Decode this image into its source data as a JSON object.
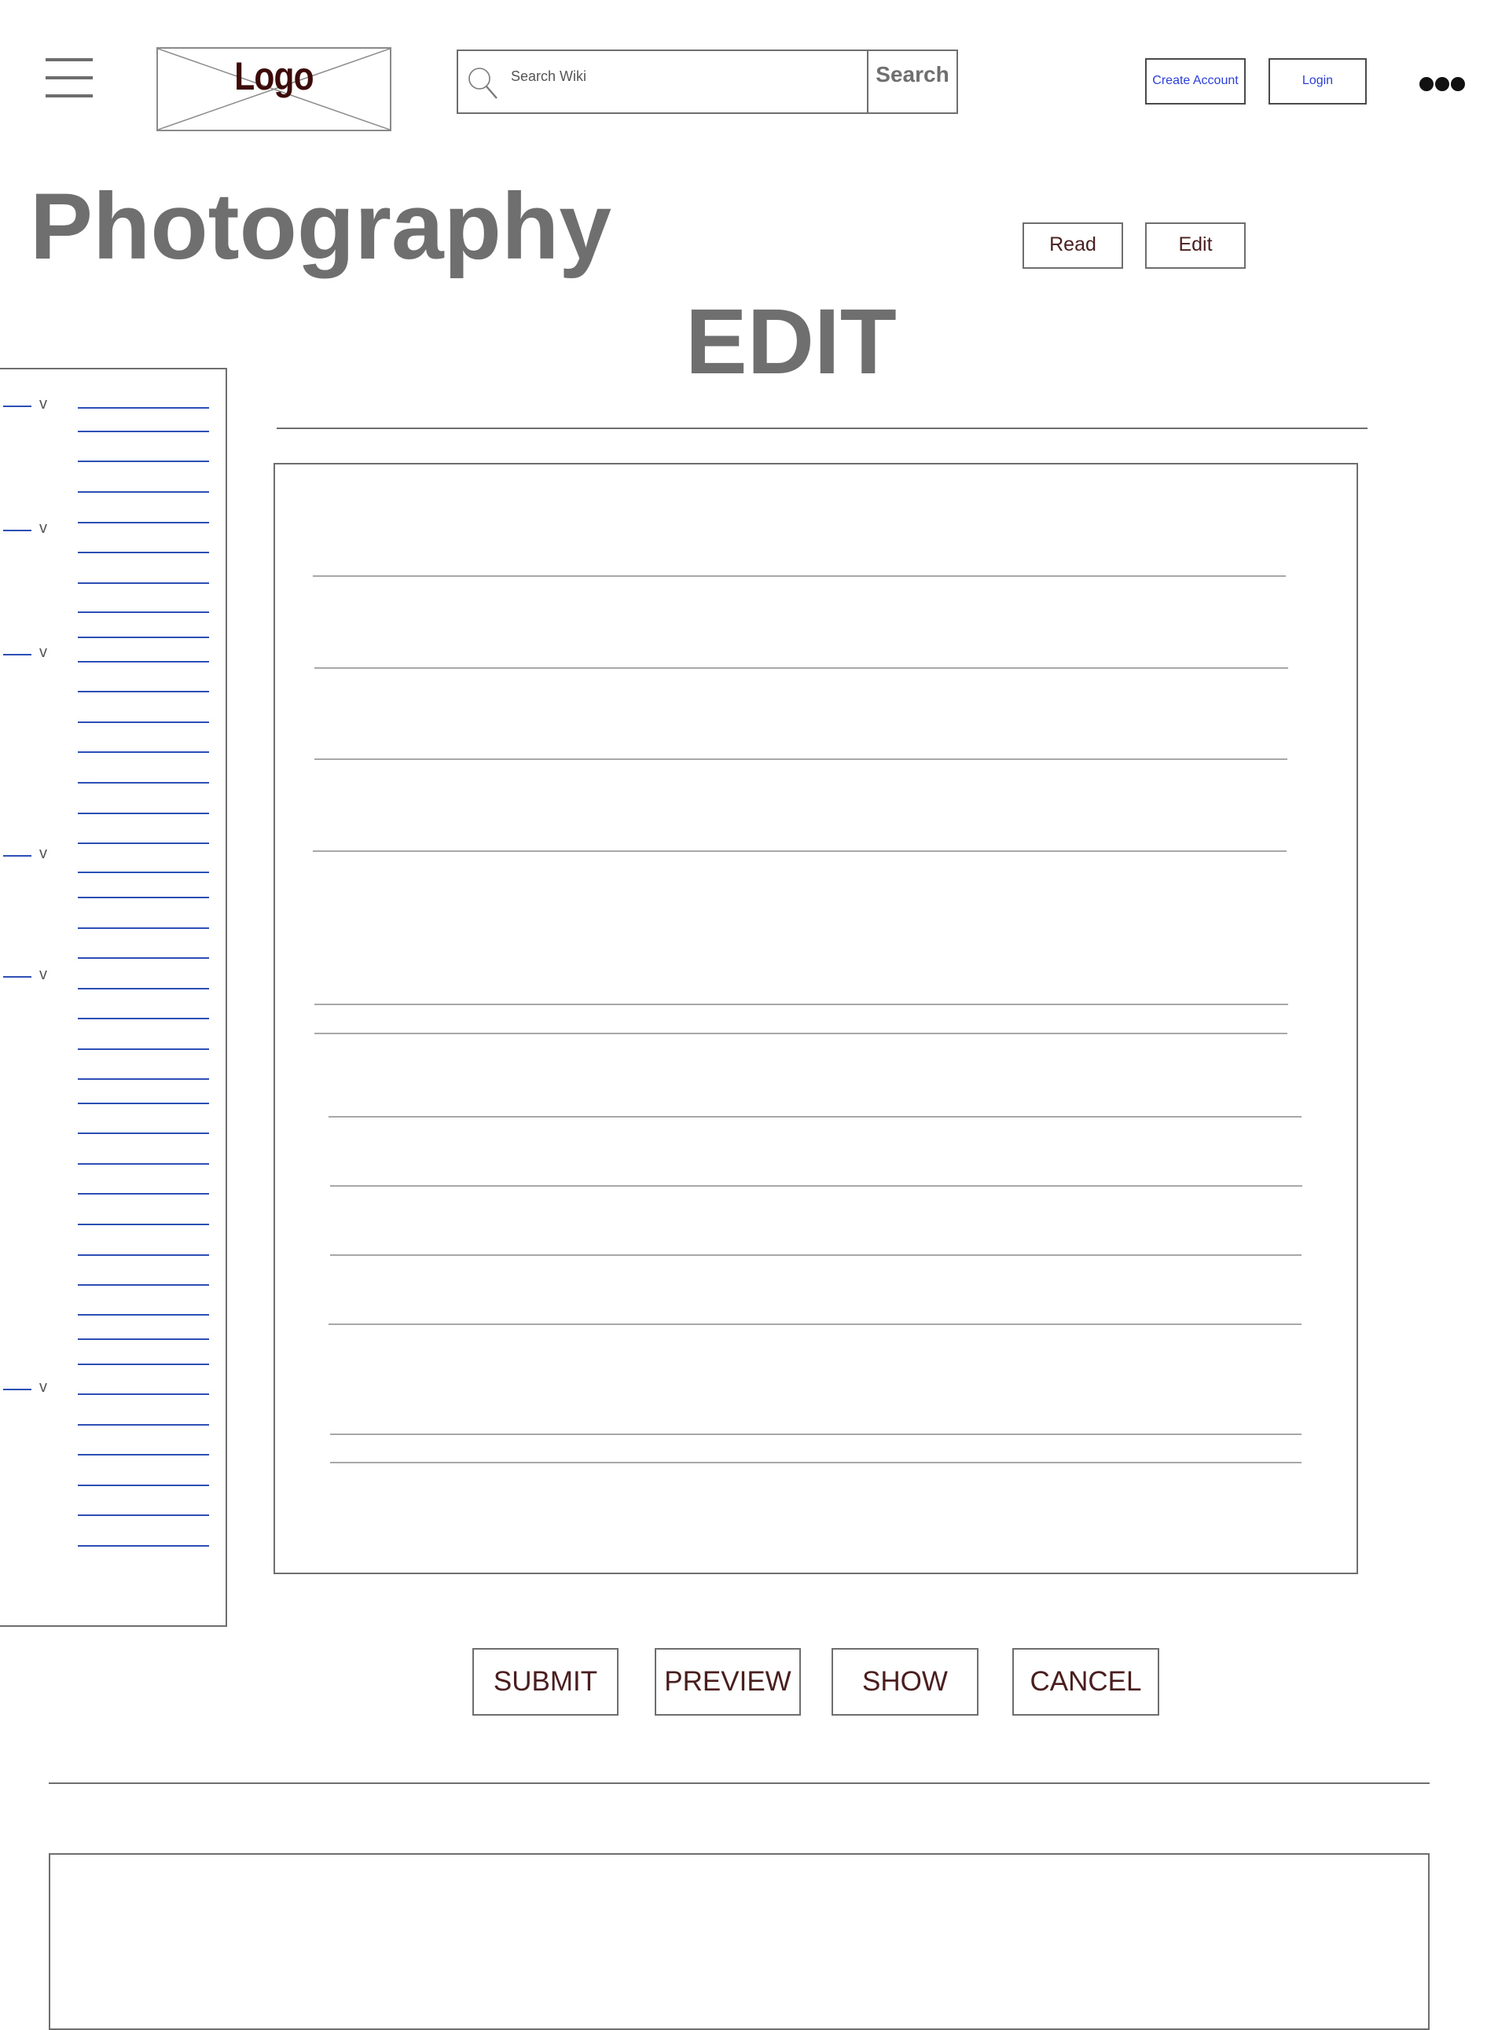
{
  "header": {
    "logo_text": "Logo",
    "search": {
      "placeholder": "Search Wiki",
      "button_label": "Search"
    },
    "create_account_label": "Create Account",
    "login_label": "Login"
  },
  "page": {
    "title": "Photography",
    "tabs": {
      "read_label": "Read",
      "edit_label": "Edit"
    },
    "mode_heading": "EDIT"
  },
  "sidebar": {
    "toc_toggle_icon": "chevron-down-icon",
    "sections": [
      {
        "toggle_label": "v"
      },
      {
        "toggle_label": "v"
      },
      {
        "toggle_label": "v"
      },
      {
        "toggle_label": "v"
      },
      {
        "toggle_label": "v"
      },
      {
        "toggle_label": "v"
      }
    ]
  },
  "actions": {
    "submit_label": "SUBMIT",
    "preview_label": "PREVIEW",
    "show_label": "SHOW",
    "cancel_label": "CANCEL"
  },
  "colors": {
    "link_blue": "#2b4fb5",
    "button_text": "#4a1e1e",
    "heading_gray": "#6f6f6f",
    "logo_text": "#3d0a0a"
  }
}
